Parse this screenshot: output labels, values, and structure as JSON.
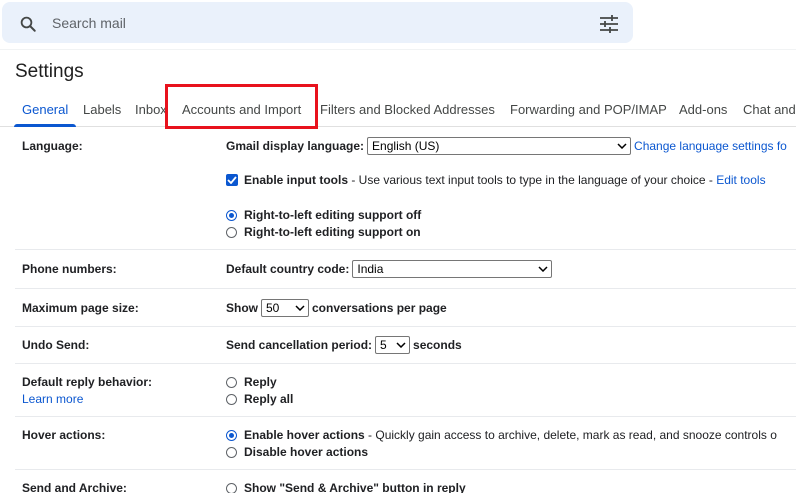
{
  "search": {
    "placeholder": "Search mail"
  },
  "page": {
    "title": "Settings"
  },
  "tabs": [
    {
      "label": "General"
    },
    {
      "label": "Labels"
    },
    {
      "label": "Inbox"
    },
    {
      "label": "Accounts and Import"
    },
    {
      "label": "Filters and Blocked Addresses"
    },
    {
      "label": "Forwarding and POP/IMAP"
    },
    {
      "label": "Add-ons"
    },
    {
      "label": "Chat and"
    }
  ],
  "colors": {
    "accent": "#0b57d0",
    "highlight": "#e8121d",
    "search_bg": "#eaf1fb"
  },
  "language": {
    "label": "Language:",
    "display_label": "Gmail display language:",
    "display_value": "English (US)",
    "change_link": "Change language settings fo",
    "input_tools_label": "Enable input tools",
    "input_tools_desc": " - Use various text input tools to type in the language of your choice - ",
    "edit_tools_link": "Edit tools",
    "input_tools_checked": true,
    "rtl_off": "Right-to-left editing support off",
    "rtl_on": "Right-to-left editing support on"
  },
  "phone": {
    "label": "Phone numbers:",
    "country_label": "Default country code:",
    "country_value": "India"
  },
  "page_size": {
    "label": "Maximum page size:",
    "show": "Show",
    "value": "50",
    "suffix": "conversations per page"
  },
  "undo_send": {
    "label": "Undo Send:",
    "period_label": "Send cancellation period:",
    "value": "5",
    "suffix": "seconds"
  },
  "reply": {
    "label": "Default reply behavior:",
    "learn_more": "Learn more",
    "reply": "Reply",
    "reply_all": "Reply all"
  },
  "hover": {
    "label": "Hover actions:",
    "enable": "Enable hover actions",
    "enable_desc": " - Quickly gain access to archive, delete, mark as read, and snooze controls o",
    "disable": "Disable hover actions"
  },
  "send_archive": {
    "label": "Send and Archive:",
    "show": "Show \"Send & Archive\" button in reply"
  }
}
